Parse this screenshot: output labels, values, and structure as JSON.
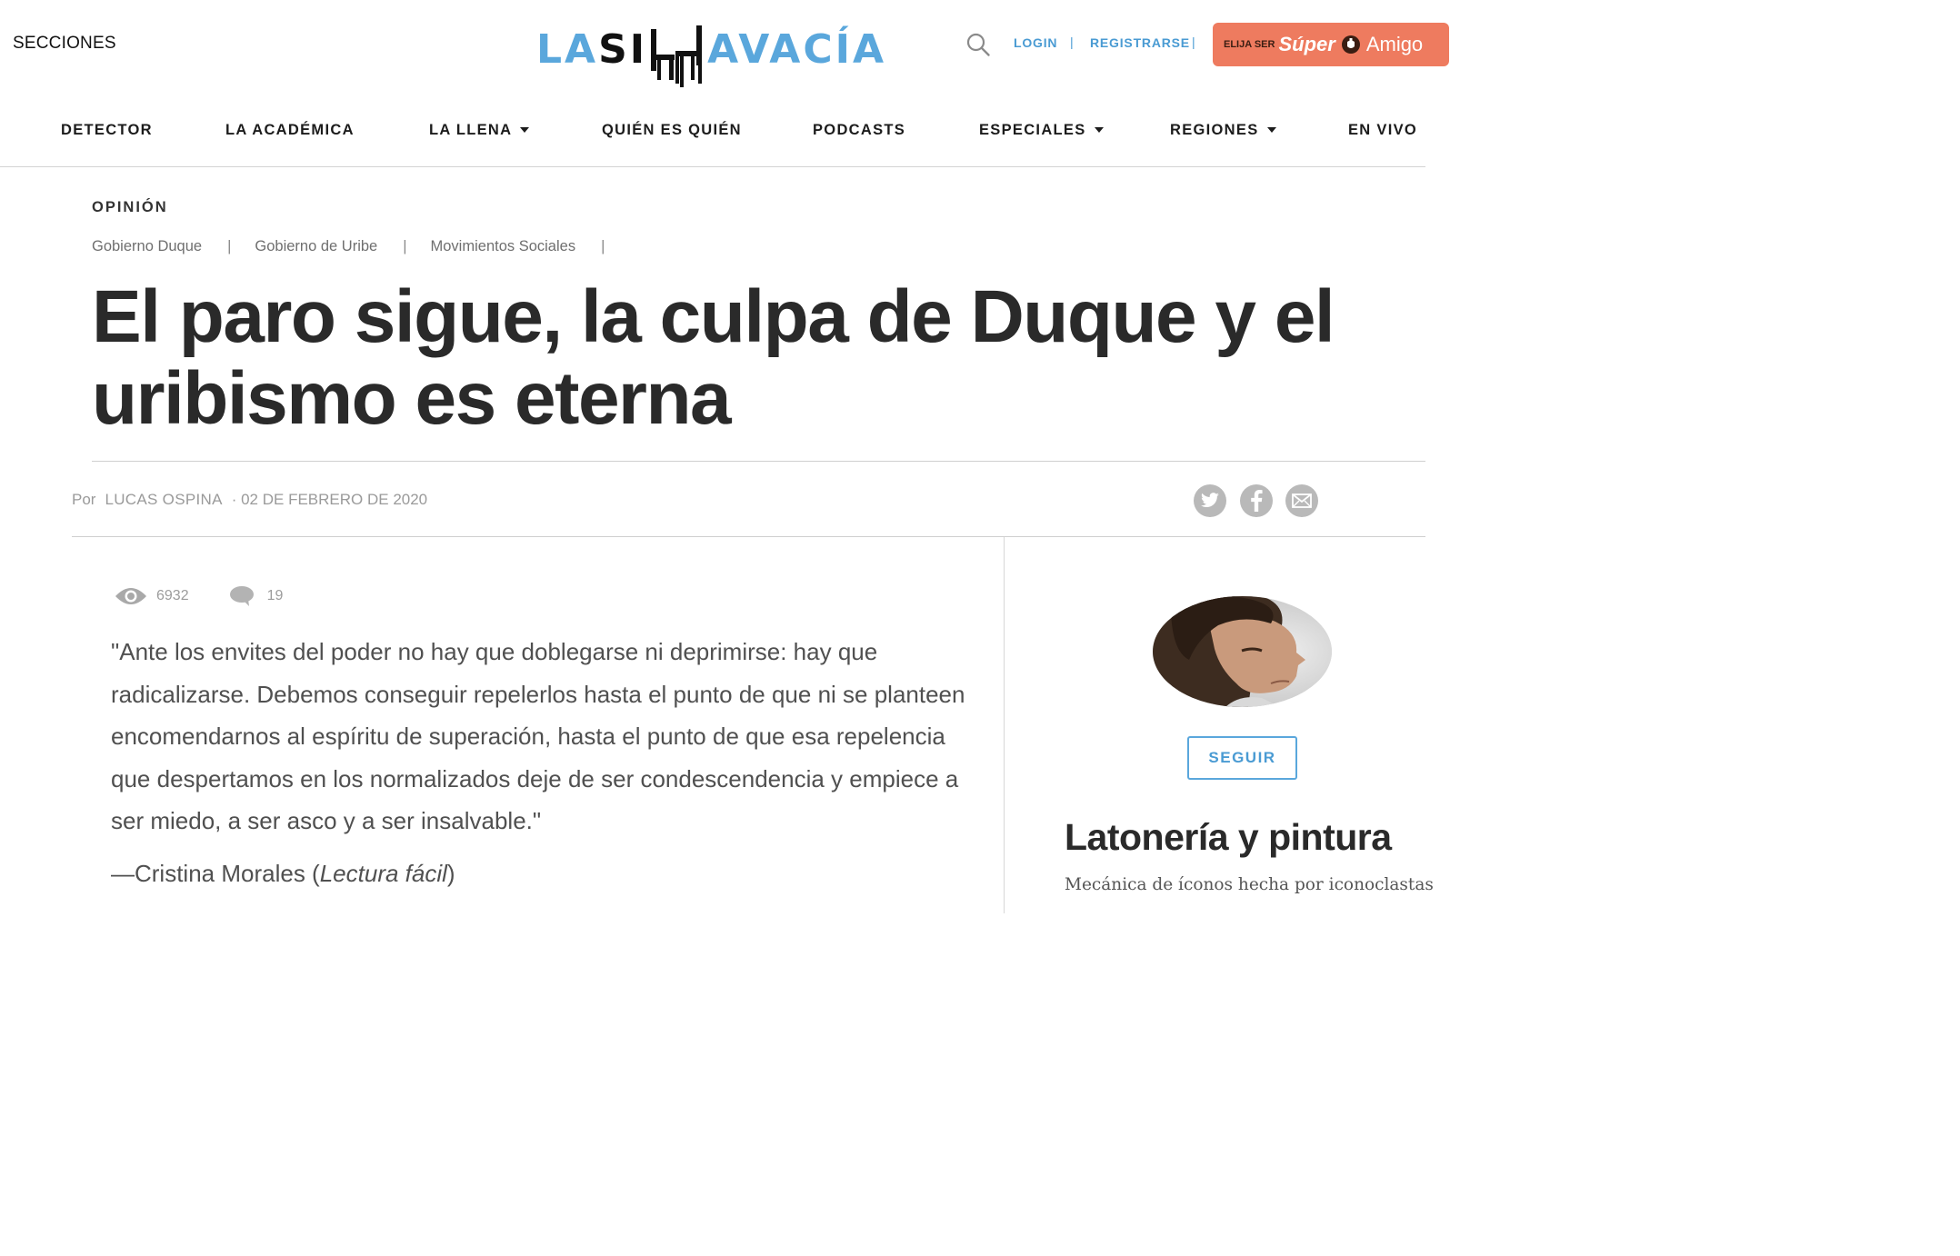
{
  "header": {
    "secciones": "SECCIONES",
    "logo": {
      "part1": "LA",
      "part2": "SI",
      "part3": "AVACÍA"
    },
    "login": "LOGIN",
    "separator": "|",
    "registrarse": "REGISTRARSE",
    "promo": {
      "small": "ELIJA SER",
      "super": "Súper",
      "amigo": "Amigo"
    }
  },
  "nav": {
    "items": [
      {
        "label": "DETECTOR"
      },
      {
        "label": "LA ACADÉMICA"
      },
      {
        "label": "LA LLENA"
      },
      {
        "label": "QUIÉN ES QUIÉN"
      },
      {
        "label": "PODCASTS"
      },
      {
        "label": "ESPECIALES"
      },
      {
        "label": "REGIONES"
      },
      {
        "label": "EN VIVO"
      }
    ]
  },
  "article": {
    "kicker": "OPINIÓN",
    "tags": [
      "Gobierno Duque",
      "Gobierno de Uribe",
      "Movimientos Sociales"
    ],
    "tag_separator": "|",
    "headline": "El paro sigue, la culpa de Duque y el uribismo es eterna",
    "byline": {
      "por": "Por",
      "author": "LUCAS OSPINA",
      "date": "· 02 DE FEBRERO DE 2020"
    },
    "stats": {
      "views": "6932",
      "comments": "19"
    },
    "quote": "\"Ante los envites del poder no hay que doblegarse ni deprimirse: hay que radicalizarse. Debemos conseguir repelerlos hasta el punto de que ni se planteen encomendarnos al espíritu de superación, hasta el punto de que esa repelencia que despertamos en los normalizados deje de ser condescendencia y empiece a ser miedo, a ser asco y a ser insalvable.\"",
    "attribution": {
      "prefix": "—Cristina Morales (",
      "work": "Lectura fácil",
      "suffix": ")"
    }
  },
  "sidebar": {
    "follow_label": "SEGUIR",
    "column_title": "Latonería y pintura",
    "column_subtitle": "Mecánica de íconos hecha por iconoclastas"
  },
  "colors": {
    "brand_blue": "#5aa7dc",
    "promo_orange": "#ee7b5f",
    "share_gray": "#b9b9b9"
  },
  "icons": [
    "search-icon",
    "twitter-icon",
    "facebook-icon",
    "email-icon",
    "eye-icon",
    "comment-icon",
    "chevron-down-icon"
  ]
}
